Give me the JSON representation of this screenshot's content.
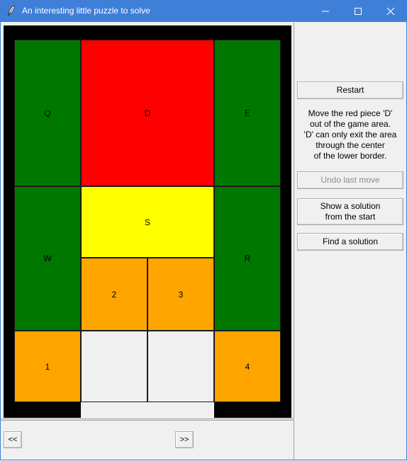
{
  "window": {
    "title": "An interesting little puzzle to solve",
    "controls": [
      "minimize",
      "maximize",
      "close"
    ]
  },
  "board": {
    "frame_color": "#000000",
    "pieces": [
      {
        "id": "Q",
        "label": "Q",
        "color": "#007800",
        "name": "piece-q"
      },
      {
        "id": "D",
        "label": "D",
        "color": "#ff0000",
        "name": "piece-d"
      },
      {
        "id": "E",
        "label": "E",
        "color": "#007800",
        "name": "piece-e"
      },
      {
        "id": "W",
        "label": "W",
        "color": "#007800",
        "name": "piece-w"
      },
      {
        "id": "S",
        "label": "S",
        "color": "#ffff00",
        "name": "piece-s"
      },
      {
        "id": "R",
        "label": "R",
        "color": "#007800",
        "name": "piece-r"
      },
      {
        "id": "2",
        "label": "2",
        "color": "#ffa500",
        "name": "piece-2"
      },
      {
        "id": "3",
        "label": "3",
        "color": "#ffa500",
        "name": "piece-3"
      },
      {
        "id": "1",
        "label": "1",
        "color": "#ffa500",
        "name": "piece-1"
      },
      {
        "id": "4",
        "label": "4",
        "color": "#ffa500",
        "name": "piece-4"
      }
    ],
    "empty_cell_color": "#f0f0f0"
  },
  "controls": {
    "restart_label": "Restart",
    "info_text": "Move the red piece 'D'\nout of the game area.\n'D' can only exit the area\nthrough the center\nof the lower border.",
    "undo_label": "Undo last move",
    "undo_enabled": false,
    "show_solution_label": "Show a solution\nfrom the start",
    "find_solution_label": "Find a solution"
  },
  "navigation": {
    "prev_label": "<<",
    "next_label": ">>"
  }
}
